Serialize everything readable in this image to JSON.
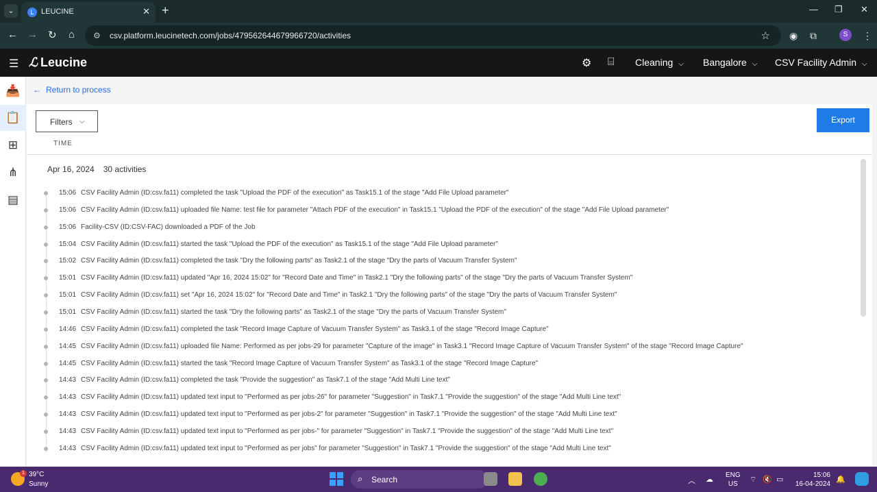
{
  "browser": {
    "tab_title": "LEUCINE",
    "url": "csv.platform.leucinetech.com/jobs/479562644679966720/activities",
    "profile_initial": "S"
  },
  "header": {
    "app_name": "Leucine",
    "use_case": "Cleaning",
    "facility": "Bangalore",
    "user_role": "CSV Facility Admin"
  },
  "page": {
    "back_label": "Return to process",
    "filters_label": "Filters",
    "export_label": "Export",
    "column_time": "TIME",
    "date": "Apr 16, 2024",
    "activity_count": "30 activities"
  },
  "activities": [
    {
      "time": "15:06",
      "text": "CSV Facility Admin (ID:csv.fa11) completed the task \"Upload the PDF of the execution\" as Task15.1 of the stage \"Add File Upload parameter\""
    },
    {
      "time": "15:06",
      "text": "CSV Facility Admin (ID:csv.fa11) uploaded file Name: test file for parameter \"Attach PDF of the execution\" in Task15.1 \"Upload the PDF of the execution\" of the stage \"Add File Upload parameter\""
    },
    {
      "time": "15:06",
      "text": "Facility-CSV (ID:CSV-FAC) downloaded a PDF of the Job"
    },
    {
      "time": "15:04",
      "text": "CSV Facility Admin (ID:csv.fa11) started the task \"Upload the PDF of the execution\" as Task15.1 of the stage \"Add File Upload parameter\""
    },
    {
      "time": "15:02",
      "text": "CSV Facility Admin (ID:csv.fa11) completed the task \"Dry the following parts\" as Task2.1 of the stage \"Dry the parts of Vacuum Transfer System\""
    },
    {
      "time": "15:01",
      "text": "CSV Facility Admin (ID:csv.fa11) updated \"Apr 16, 2024 15:02\" for \"Record Date and Time\" in Task2.1 \"Dry the following parts\" of the stage \"Dry the parts of Vacuum Transfer System\""
    },
    {
      "time": "15:01",
      "text": "CSV Facility Admin (ID:csv.fa11) set \"Apr 16, 2024 15:02\" for \"Record Date and Time\" in Task2.1 \"Dry the following parts\" of the stage \"Dry the parts of Vacuum Transfer System\""
    },
    {
      "time": "15:01",
      "text": "CSV Facility Admin (ID:csv.fa11) started the task \"Dry the following parts\" as Task2.1 of the stage \"Dry the parts of Vacuum Transfer System\""
    },
    {
      "time": "14:46",
      "text": "CSV Facility Admin (ID:csv.fa11) completed the task \"Record Image Capture of Vacuum Transfer System\" as Task3.1 of the stage \"Record Image Capture\""
    },
    {
      "time": "14:45",
      "text": "CSV Facility Admin (ID:csv.fa11) uploaded file Name: Performed as per jobs-29 for parameter \"Capture of the image\" in Task3.1 \"Record Image Capture of Vacuum Transfer System\" of the stage \"Record Image Capture\""
    },
    {
      "time": "14:45",
      "text": "CSV Facility Admin (ID:csv.fa11) started the task \"Record Image Capture of Vacuum Transfer System\" as Task3.1 of the stage \"Record Image Capture\""
    },
    {
      "time": "14:43",
      "text": "CSV Facility Admin (ID:csv.fa11) completed the task \"Provide the suggestion\" as Task7.1 of the stage \"Add Multi Line text\""
    },
    {
      "time": "14:43",
      "text": "CSV Facility Admin (ID:csv.fa11) updated text input to \"Performed as per jobs-26\" for parameter \"Suggestion\" in Task7.1 \"Provide the suggestion\" of the stage \"Add Multi Line text\""
    },
    {
      "time": "14:43",
      "text": "CSV Facility Admin (ID:csv.fa11) updated text input to \"Performed as per jobs-2\" for parameter \"Suggestion\" in Task7.1 \"Provide the suggestion\" of the stage \"Add Multi Line text\""
    },
    {
      "time": "14:43",
      "text": "CSV Facility Admin (ID:csv.fa11) updated text input to \"Performed as per jobs-\" for parameter \"Suggestion\" in Task7.1 \"Provide the suggestion\" of the stage \"Add Multi Line text\""
    },
    {
      "time": "14:43",
      "text": "CSV Facility Admin (ID:csv.fa11) updated text input to \"Performed as per jobs\" for parameter \"Suggestion\" in Task7.1 \"Provide the suggestion\" of the stage \"Add Multi Line text\""
    }
  ],
  "taskbar": {
    "temperature": "39°C",
    "weather": "Sunny",
    "weather_badge": "1",
    "search_label": "Search",
    "lang_top": "ENG",
    "lang_bottom": "US",
    "time": "15:06",
    "date": "16-04-2024"
  },
  "icons": {
    "tab_menu": "chevron-down-icon",
    "side_nav": [
      "inbox-icon",
      "clipboard-icon",
      "hierarchy-icon",
      "sitemap-icon",
      "report-icon"
    ]
  }
}
